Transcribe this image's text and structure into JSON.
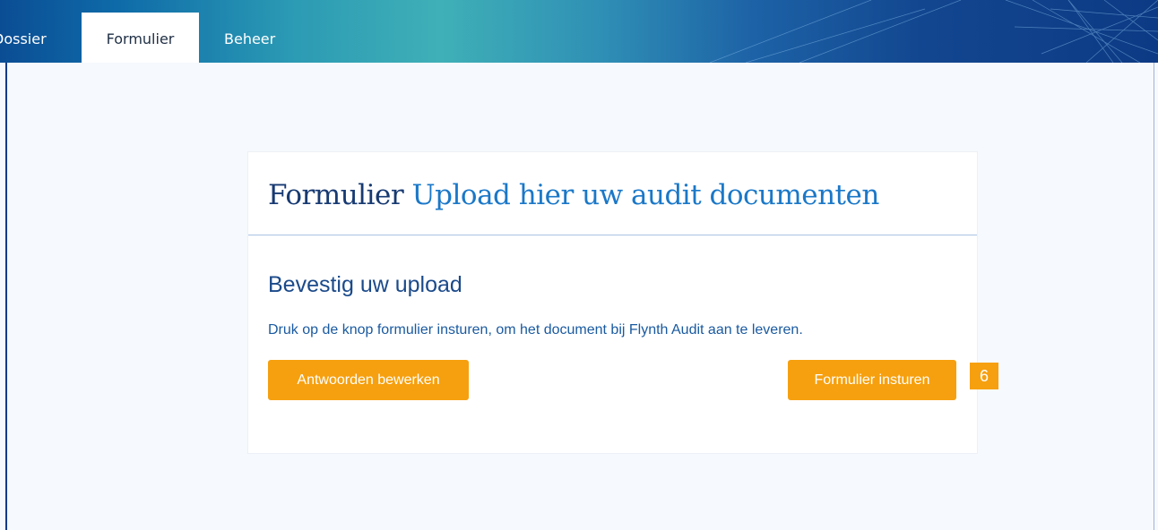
{
  "nav": {
    "tabs": [
      {
        "label": "Dossier"
      },
      {
        "label": "Formulier"
      },
      {
        "label": "Beheer"
      }
    ],
    "active_tab": "Formulier"
  },
  "card": {
    "title_main": "Formulier",
    "title_sub": "Upload hier uw audit documenten",
    "section_title": "Bevestig uw upload",
    "instruction": "Druk op de knop formulier insturen, om het document bij Flynth Audit aan te leveren.",
    "edit_button": "Antwoorden bewerken",
    "submit_button": "Formulier insturen",
    "step_badge": "6"
  },
  "colors": {
    "accent": "#f6a00f",
    "title_dark": "#173a72",
    "title_light": "#1a78c8",
    "text_blue": "#1a5aa0"
  }
}
